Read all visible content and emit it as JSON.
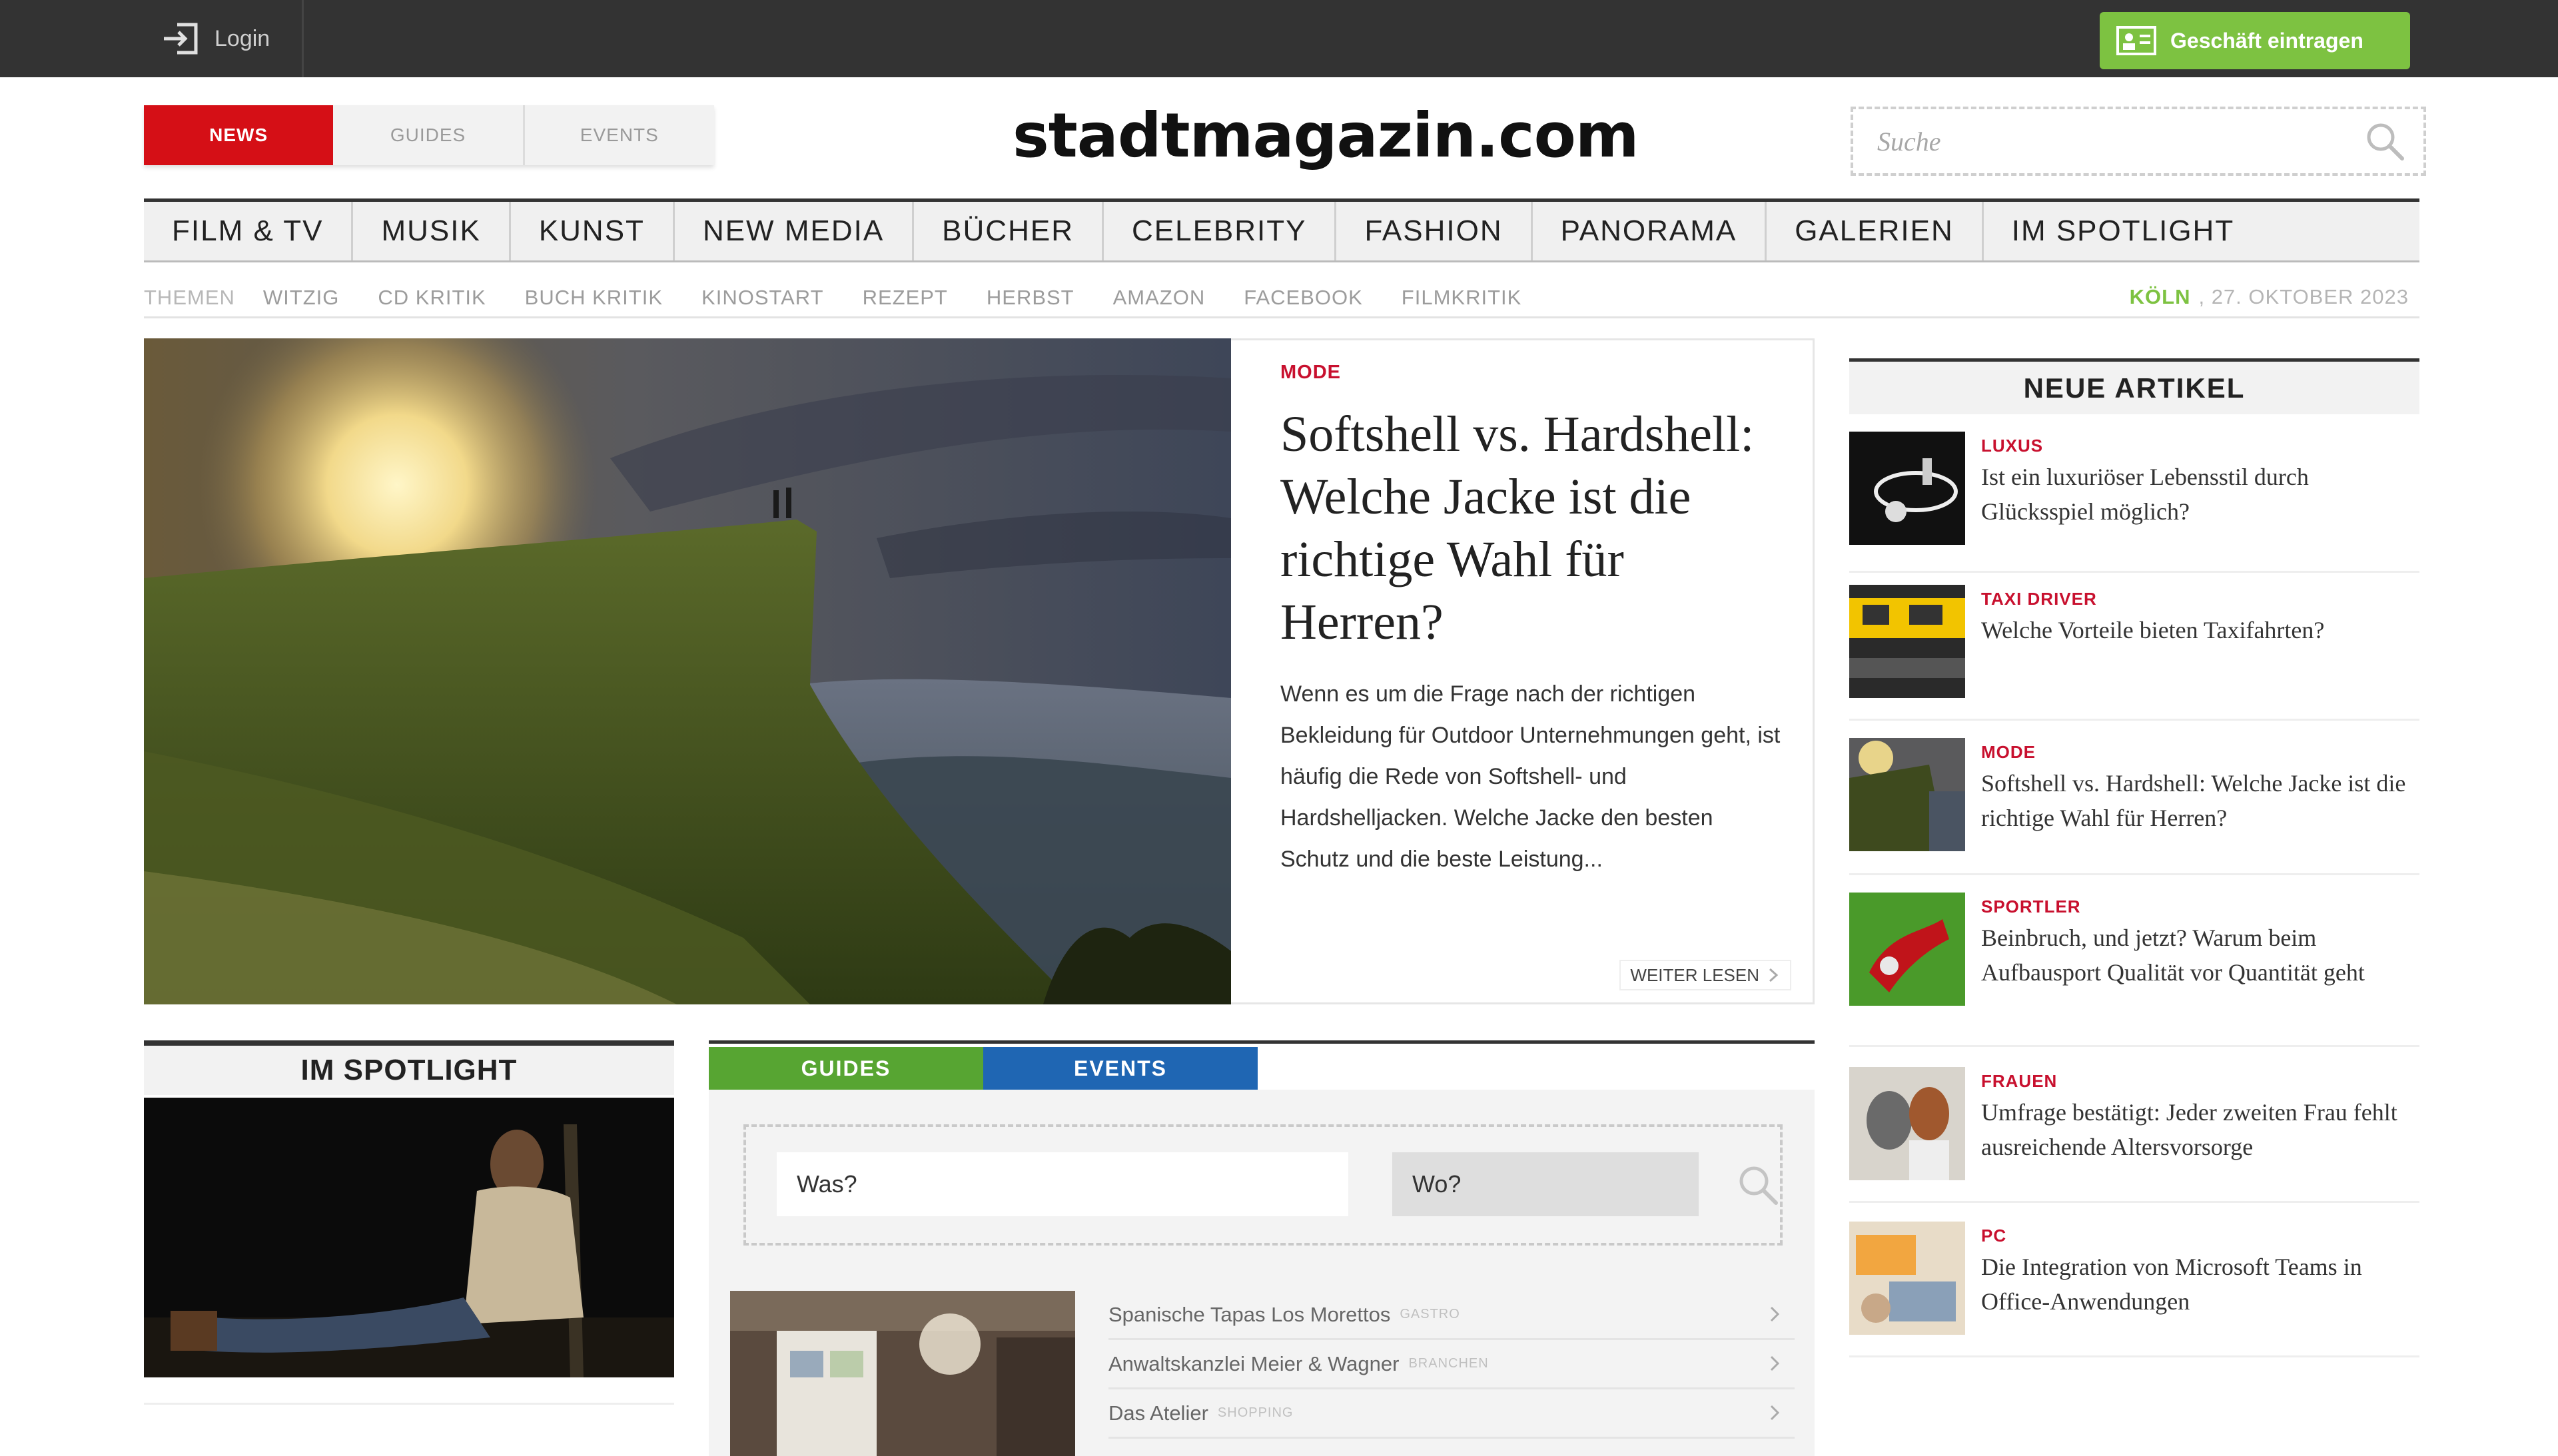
{
  "topbar": {
    "login_label": "Login",
    "business_button_label": "Geschäft eintragen"
  },
  "header": {
    "tabs": [
      {
        "label": "NEWS",
        "active": true
      },
      {
        "label": "GUIDES",
        "active": false
      },
      {
        "label": "EVENTS",
        "active": false
      }
    ],
    "logo": "stadtmagazin.com",
    "search_placeholder": "Suche"
  },
  "main_nav": [
    "FILM & TV",
    "MUSIK",
    "KUNST",
    "NEW MEDIA",
    "BÜCHER",
    "CELEBRITY",
    "FASHION",
    "PANORAMA",
    "GALERIEN",
    "IM SPOTLIGHT"
  ],
  "sub_nav": {
    "label": "THEMEN",
    "tags": [
      "WITZIG",
      "CD KRITIK",
      "BUCH KRITIK",
      "KINOSTART",
      "REZEPT",
      "HERBST",
      "AMAZON",
      "FACEBOOK",
      "FILMKRITIK"
    ],
    "city": "KÖLN",
    "date": ", 27. OKTOBER 2023"
  },
  "hero": {
    "category": "MODE",
    "title": "Softshell vs. Hardshell: Welche Jacke ist die richtige Wahl für Herren?",
    "excerpt": "Wenn es um die Frage nach der richtigen Bekleidung für Outdoor Unternehmungen geht, ist häufig die Rede von Softshell- und Hardshelljacken. Welche Jacke den besten Schutz und die beste Leistung...",
    "read_more": "WEITER LESEN"
  },
  "neue_artikel": {
    "heading": "NEUE ARTIKEL",
    "items": [
      {
        "category": "LUXUS",
        "title": "Ist ein luxuriöser Lebensstil durch Glücksspiel möglich?"
      },
      {
        "category": "TAXI DRIVER",
        "title": "Welche Vorteile bieten Taxifahrten?"
      },
      {
        "category": "MODE",
        "title": "Softshell vs. Hardshell: Welche Jacke ist die richtige Wahl für Herren?"
      },
      {
        "category": "SPORTLER",
        "title": "Beinbruch, und jetzt? Warum beim Aufbausport Qualität vor Quantität geht"
      },
      {
        "category": "FRAUEN",
        "title": "Umfrage bestätigt: Jeder zweiten Frau fehlt ausreichende Altersvorsorge"
      },
      {
        "category": "PC",
        "title": "Die Integration von Microsoft Teams in Office-Anwendungen"
      }
    ]
  },
  "spotlight": {
    "heading": "IM SPOTLIGHT"
  },
  "guides_events": {
    "tabs": [
      "GUIDES",
      "EVENTS"
    ],
    "was_placeholder": "Was?",
    "wo_placeholder": "Wo?",
    "listings": [
      {
        "name": "Spanische Tapas Los Morettos",
        "tag": "GASTRO"
      },
      {
        "name": "Anwaltskanzlei Meier & Wagner",
        "tag": "BRANCHEN"
      },
      {
        "name": "Das Atelier",
        "tag": "SHOPPING"
      }
    ]
  },
  "colors": {
    "accent_red": "#d50f16",
    "category_red": "#c8102e",
    "green": "#7dc241",
    "blue": "#1f66b3",
    "topbar": "#333333"
  }
}
